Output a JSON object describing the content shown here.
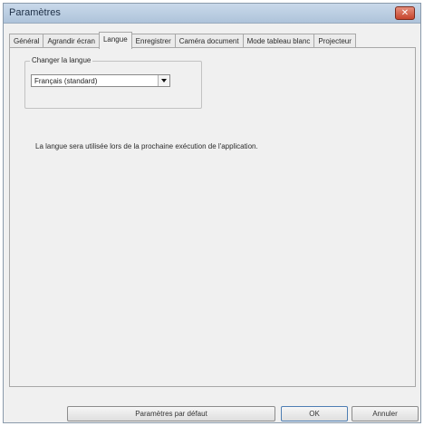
{
  "window": {
    "title": "Paramètres",
    "close_symbol": "✕"
  },
  "tabs": [
    {
      "label": "Général",
      "active": false
    },
    {
      "label": "Agrandir écran",
      "active": false
    },
    {
      "label": "Langue",
      "active": true
    },
    {
      "label": "Enregistrer",
      "active": false
    },
    {
      "label": "Caméra document",
      "active": false
    },
    {
      "label": "Mode tableau blanc",
      "active": false
    },
    {
      "label": "Projecteur",
      "active": false
    }
  ],
  "language_group": {
    "label": "Changer la langue",
    "selected": "Français (standard)"
  },
  "info": "La langue sera utilisée lors de la prochaine exécution de l'application.",
  "buttons": {
    "default": "Paramètres par défaut",
    "ok": "OK",
    "cancel": "Annuler"
  },
  "icons": {
    "close": "close-icon",
    "dropdown": "chevron-down-icon"
  }
}
